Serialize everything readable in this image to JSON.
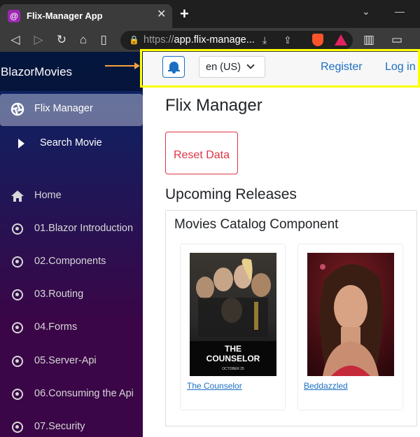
{
  "browser": {
    "tab_title": "Flix-Manager App",
    "new_tab_symbol": "+",
    "url_scheme": "https://",
    "url_host": "app.flix-manage..."
  },
  "sidebar": {
    "brand": "BlazorMovies",
    "items": [
      {
        "label": "Flix Manager",
        "icon": "aperture-icon",
        "active": true
      },
      {
        "label": "Search Movie",
        "icon": "caret-right-icon",
        "active": false
      },
      {
        "label": "Home",
        "icon": "home-icon",
        "active": false
      },
      {
        "label": "01.Blazor Introduction",
        "icon": "target-icon",
        "active": false
      },
      {
        "label": "02.Components",
        "icon": "target-icon",
        "active": false
      },
      {
        "label": "03.Routing",
        "icon": "target-icon",
        "active": false
      },
      {
        "label": "04.Forms",
        "icon": "target-icon",
        "active": false
      },
      {
        "label": "05.Server-Api",
        "icon": "target-icon",
        "active": false
      },
      {
        "label": "06.Consuming the Api",
        "icon": "target-icon",
        "active": false
      },
      {
        "label": "07.Security",
        "icon": "target-icon",
        "active": false
      }
    ]
  },
  "topbar": {
    "language": "en (US)",
    "register": "Register",
    "login": "Log in"
  },
  "main": {
    "title": "Flix Manager",
    "reset_button": "Reset Data",
    "section_title": "Upcoming Releases",
    "catalog_title": "Movies Catalog Component",
    "movies": [
      {
        "title": "The Counselor",
        "poster_text_1": "THE",
        "poster_text_2": "COUNSELOR",
        "poster_date": "OCTOBER 25"
      },
      {
        "title": "Beddazzled"
      }
    ]
  },
  "colors": {
    "accent": "#1b6ec2",
    "danger": "#dc3545",
    "highlight": "#ffff00",
    "arrow": "#f5a142"
  }
}
